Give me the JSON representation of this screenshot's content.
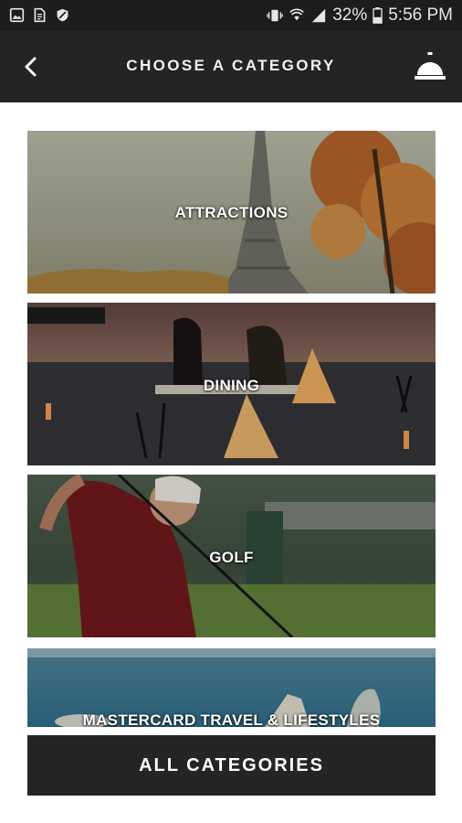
{
  "status_bar": {
    "battery": "32%",
    "time": "5:56 PM",
    "left_icons": [
      "gallery-icon",
      "document-icon",
      "shield-icon"
    ],
    "right_icons": [
      "vibrate-icon",
      "wifi-icon",
      "signal-icon",
      "battery-icon"
    ]
  },
  "header": {
    "title": "CHOOSE A CATEGORY",
    "back_icon": "chevron-left-icon",
    "concierge_icon": "concierge-bell-icon"
  },
  "categories": [
    {
      "label": "ATTRACTIONS"
    },
    {
      "label": "DINING"
    },
    {
      "label": "GOLF"
    },
    {
      "label": "MASTERCARD TRAVEL & LIFESTYLES"
    }
  ],
  "footer": {
    "all_categories_label": "ALL CATEGORIES"
  }
}
